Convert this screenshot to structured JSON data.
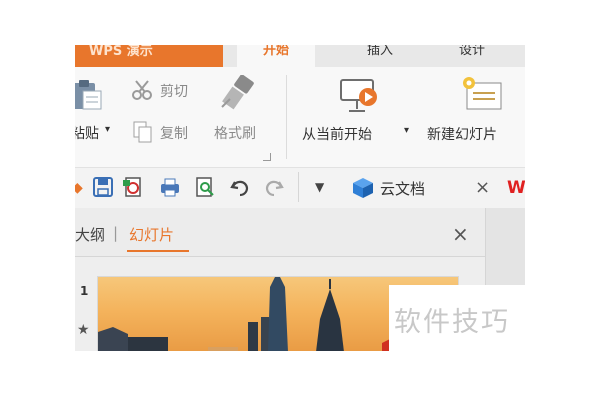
{
  "ribbon_tabs": {
    "app": "WPS 演示",
    "home": "开始",
    "insert": "插入",
    "design": "设计"
  },
  "clipboard": {
    "paste_label": "粘贴",
    "cut_label": "剪切",
    "copy_label": "复制",
    "format_painter_label": "格式刷"
  },
  "slideshow": {
    "from_current_label": "从当前开始",
    "new_slide_label": "新建幻灯片"
  },
  "quick_access": {
    "cloud_docs_label": "云文档",
    "close_glyph": "×"
  },
  "panel": {
    "outline_tab": "大纲",
    "separator": "|",
    "slides_tab": "幻灯片",
    "close_glyph": "×",
    "slide_number": "1",
    "star_glyph": "★"
  },
  "watermark": "软件技巧",
  "colors": {
    "accent": "#e8762c",
    "cloud_icon": "#2f7fd6",
    "wps_logo": "#e02020"
  },
  "icons": [
    "paste-icon",
    "scissors-icon",
    "copy-icon",
    "format-painter-icon",
    "projector-play-icon",
    "new-slide-icon",
    "save-icon",
    "print-preview-icon",
    "print-icon",
    "undo-icon",
    "redo-icon",
    "cloud-box-icon",
    "wps-logo-icon"
  ]
}
